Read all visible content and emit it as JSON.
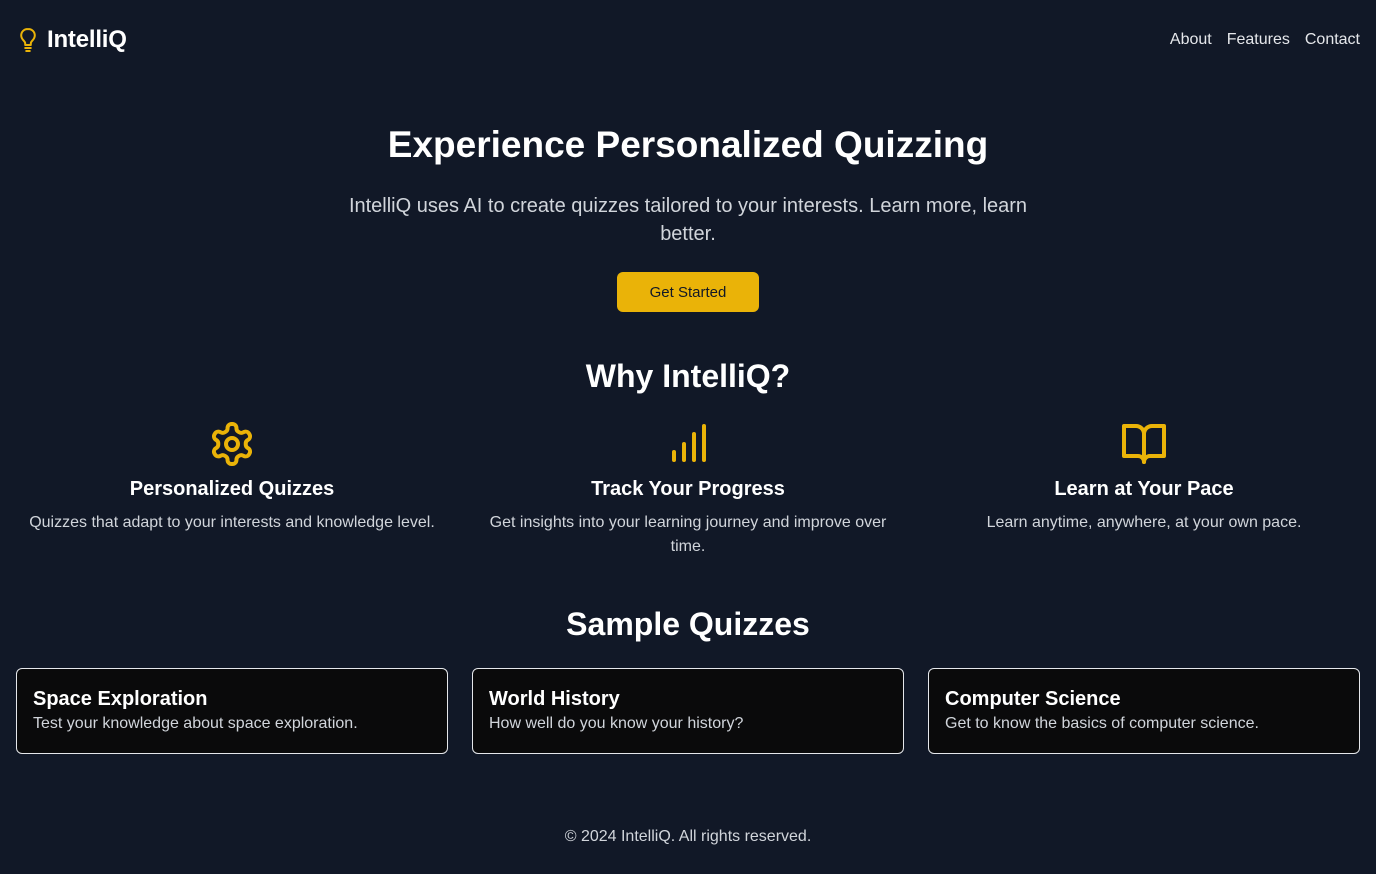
{
  "colors": {
    "background": "#111827",
    "accent": "#eab308",
    "card_background": "#0a0a0b",
    "text_muted": "#d1d5db"
  },
  "header": {
    "brand_icon": "lightbulb-icon",
    "brand_name": "IntelliQ",
    "nav": [
      {
        "label": "About"
      },
      {
        "label": "Features"
      },
      {
        "label": "Contact"
      }
    ]
  },
  "hero": {
    "title": "Experience Personalized Quizzing",
    "subtitle": "IntelliQ uses AI to create quizzes tailored to your interests. Learn more, learn better.",
    "cta_label": "Get Started"
  },
  "why": {
    "title": "Why IntelliQ?",
    "features": [
      {
        "icon": "gear-icon",
        "title": "Personalized Quizzes",
        "description": "Quizzes that adapt to your interests and knowledge level."
      },
      {
        "icon": "bar-chart-icon",
        "title": "Track Your Progress",
        "description": "Get insights into your learning journey and improve over time."
      },
      {
        "icon": "book-open-icon",
        "title": "Learn at Your Pace",
        "description": "Learn anytime, anywhere, at your own pace."
      }
    ]
  },
  "samples": {
    "title": "Sample Quizzes",
    "quizzes": [
      {
        "title": "Space Exploration",
        "description": "Test your knowledge about space exploration."
      },
      {
        "title": "World History",
        "description": "How well do you know your history?"
      },
      {
        "title": "Computer Science",
        "description": "Get to know the basics of computer science."
      }
    ]
  },
  "footer": {
    "text": "© 2024 IntelliQ. All rights reserved."
  }
}
